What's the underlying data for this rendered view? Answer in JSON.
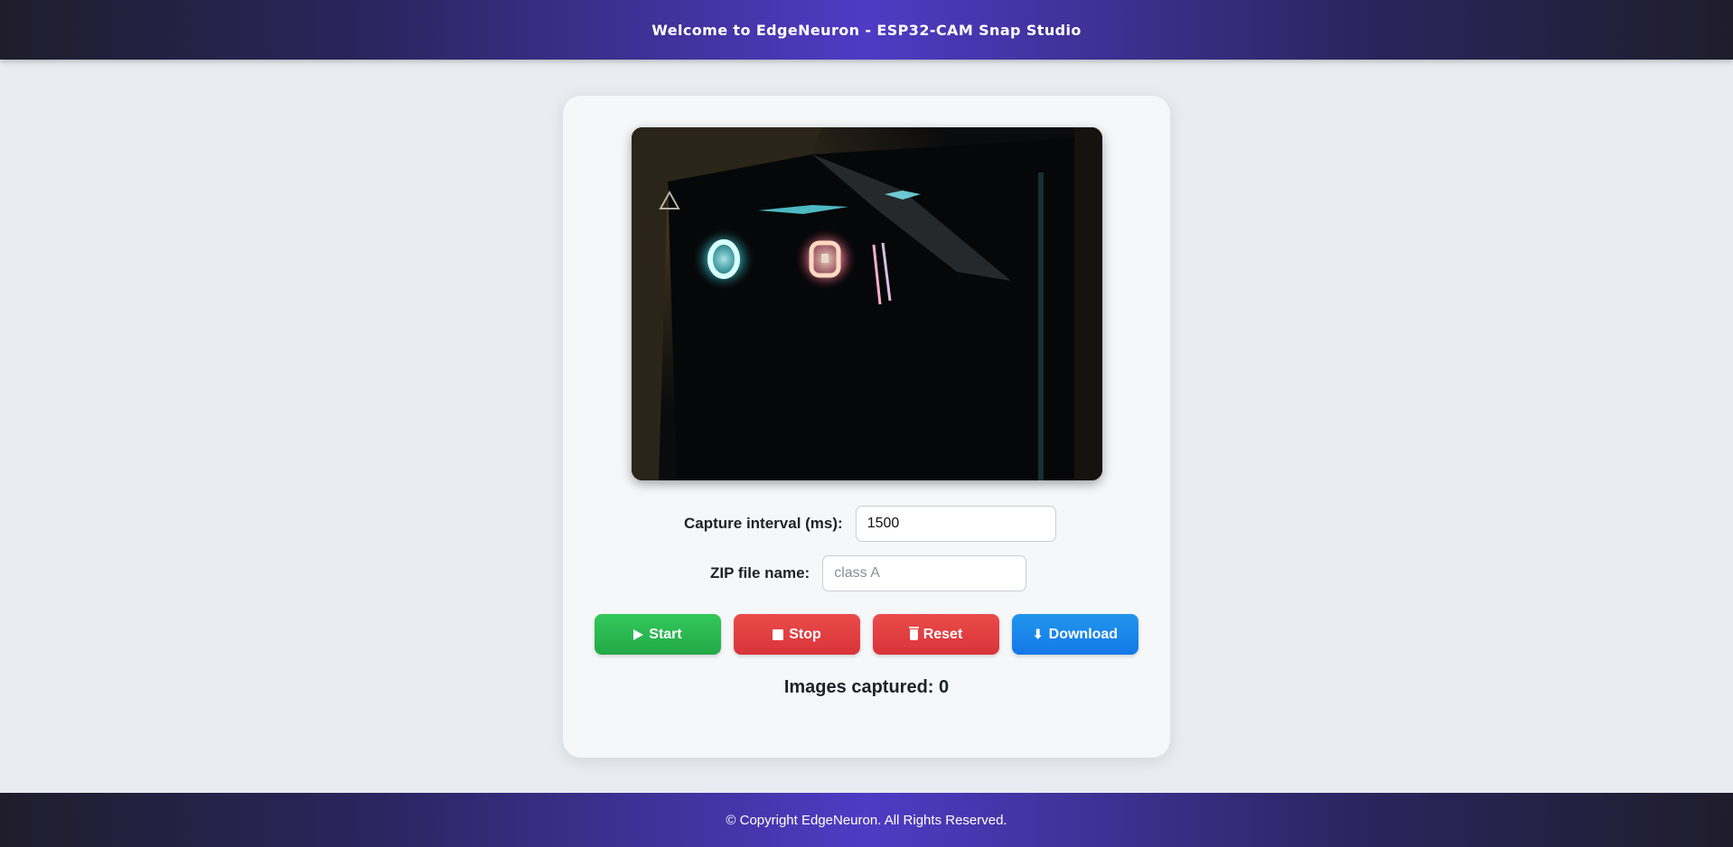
{
  "header": {
    "title": "Welcome to EdgeNeuron - ESP32-CAM Snap Studio"
  },
  "camera": {
    "icon": "camera-feed-image"
  },
  "form": {
    "interval_label": "Capture interval (ms):",
    "interval_value": "1500",
    "zip_label": "ZIP file name:",
    "zip_placeholder": "class A",
    "zip_value": ""
  },
  "buttons": {
    "start_label": "Start",
    "stop_label": "Stop",
    "reset_label": "Reset",
    "download_label": "Download",
    "start_icon": "play-icon",
    "stop_icon": "stop-icon",
    "reset_icon": "trash-icon",
    "download_icon": "download-arrow-icon"
  },
  "status": {
    "text": "Images captured: 0"
  },
  "footer": {
    "text": "© Copyright EdgeNeuron. All Rights Reserved."
  },
  "colors": {
    "accent_purple": "#4f3bc4",
    "start_green": "#28b24f",
    "stop_red": "#e03a40",
    "download_blue": "#1a86ea"
  }
}
